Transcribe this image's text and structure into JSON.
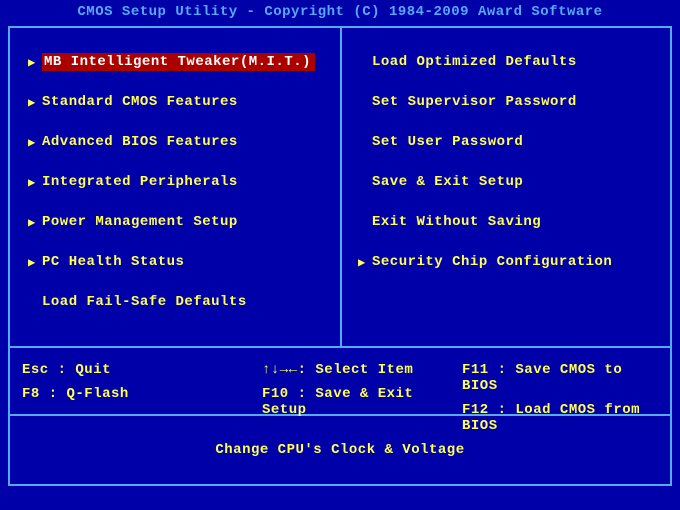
{
  "title": "CMOS Setup Utility - Copyright (C) 1984-2009 Award Software",
  "left_menu": [
    {
      "label": "MB Intelligent Tweaker(M.I.T.)",
      "tri": true,
      "selected": true
    },
    {
      "label": "Standard CMOS Features",
      "tri": true,
      "selected": false
    },
    {
      "label": "Advanced BIOS Features",
      "tri": true,
      "selected": false
    },
    {
      "label": "Integrated Peripherals",
      "tri": true,
      "selected": false
    },
    {
      "label": "Power Management Setup",
      "tri": true,
      "selected": false
    },
    {
      "label": "PC Health Status",
      "tri": true,
      "selected": false
    },
    {
      "label": "Load Fail-Safe Defaults",
      "tri": false,
      "selected": false
    }
  ],
  "right_menu": [
    {
      "label": "Load Optimized Defaults",
      "tri": false,
      "selected": false
    },
    {
      "label": "Set Supervisor Password",
      "tri": false,
      "selected": false
    },
    {
      "label": "Set User Password",
      "tri": false,
      "selected": false
    },
    {
      "label": "Save & Exit Setup",
      "tri": false,
      "selected": false
    },
    {
      "label": "Exit Without Saving",
      "tri": false,
      "selected": false
    },
    {
      "label": "Security Chip Configuration",
      "tri": true,
      "selected": false
    }
  ],
  "help": {
    "c1a": "Esc : Quit",
    "c1b": "F8  : Q-Flash",
    "c2a": "↑↓→←: Select Item",
    "c2b": "F10 : Save & Exit Setup",
    "c3a": "F11 : Save CMOS to BIOS",
    "c3b": "F12 : Load CMOS from BIOS"
  },
  "hint": "Change CPU's Clock & Voltage"
}
